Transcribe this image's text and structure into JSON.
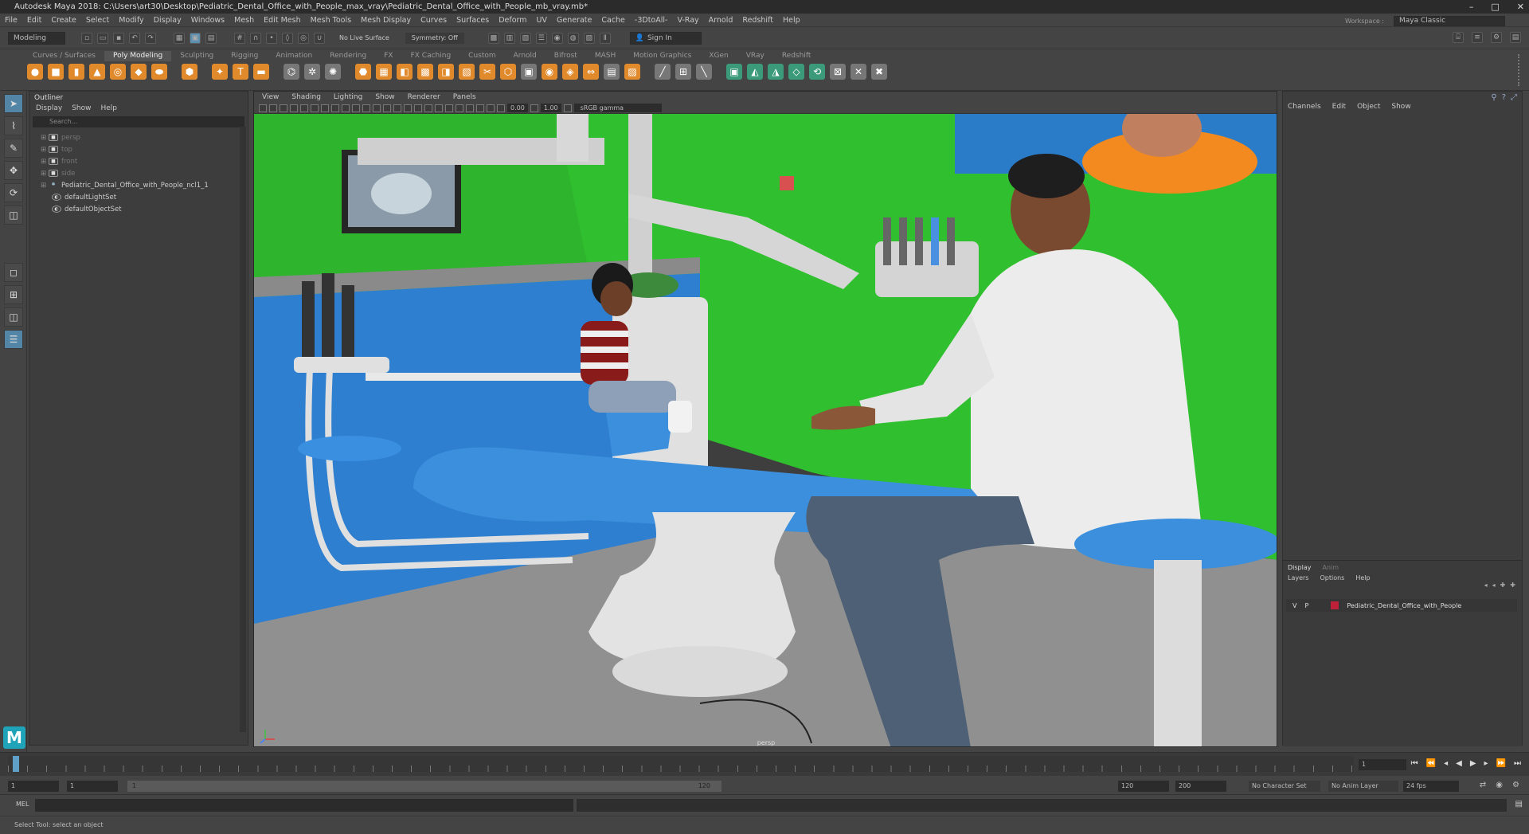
{
  "title": "Autodesk Maya 2018: C:\\Users\\art30\\Desktop\\Pediatric_Dental_Office_with_People_max_vray\\Pediatric_Dental_Office_with_People_mb_vray.mb*",
  "window_controls": [
    "–",
    "□",
    "✕"
  ],
  "menus": [
    "File",
    "Edit",
    "Create",
    "Select",
    "Modify",
    "Display",
    "Windows",
    "Mesh",
    "Edit Mesh",
    "Mesh Tools",
    "Mesh Display",
    "Curves",
    "Surfaces",
    "Deform",
    "UV",
    "Generate",
    "Cache",
    "-3DtoAll-",
    "V-Ray",
    "Arnold",
    "Redshift",
    "Help"
  ],
  "workspace": {
    "label": "Workspace :",
    "value": "Maya Classic"
  },
  "status": {
    "mode": "Modeling",
    "live_surface": "No Live Surface",
    "symmetry": "Symmetry: Off",
    "sign_in": "Sign In"
  },
  "shelf_tabs": [
    "Curves / Surfaces",
    "Poly Modeling",
    "Sculpting",
    "Rigging",
    "Animation",
    "Rendering",
    "FX",
    "FX Caching",
    "Custom",
    "Arnold",
    "Bifrost",
    "MASH",
    "Motion Graphics",
    "XGen",
    "VRay",
    "Redshift"
  ],
  "shelf_active": "Poly Modeling",
  "outliner": {
    "title": "Outliner",
    "menu": [
      "Display",
      "Show",
      "Help"
    ],
    "search_placeholder": "Search...",
    "items": [
      {
        "label": "persp",
        "dim": true
      },
      {
        "label": "top",
        "dim": true
      },
      {
        "label": "front",
        "dim": true
      },
      {
        "label": "side",
        "dim": true
      },
      {
        "label": "Pediatric_Dental_Office_with_People_ncl1_1",
        "dim": false
      },
      {
        "label": "defaultLightSet",
        "dim": false
      },
      {
        "label": "defaultObjectSet",
        "dim": false
      }
    ]
  },
  "viewport": {
    "menu": [
      "View",
      "Shading",
      "Lighting",
      "Show",
      "Renderer",
      "Panels"
    ],
    "value_a": "0.00",
    "value_b": "1.00",
    "colorspace": "sRGB gamma",
    "camera_label": "persp"
  },
  "channel_box": {
    "menu": [
      "Channels",
      "Edit",
      "Object",
      "Show"
    ],
    "layer_tabs": [
      "Display",
      "Anim"
    ],
    "layer_menu": [
      "Layers",
      "Options",
      "Help"
    ],
    "layer": {
      "v": "V",
      "p": "P",
      "name": "Pediatric_Dental_Office_with_People",
      "color": "#c0213a"
    }
  },
  "range": {
    "start": "1",
    "start2": "1",
    "slider_start": "1",
    "slider_end": "120",
    "end": "120",
    "end2": "200",
    "character_set": "No Character Set",
    "anim_layer": "No Anim Layer",
    "fps": "24 fps"
  },
  "current_frame": "1",
  "command_line_label": "MEL",
  "help_line": "Select Tool: select an object"
}
